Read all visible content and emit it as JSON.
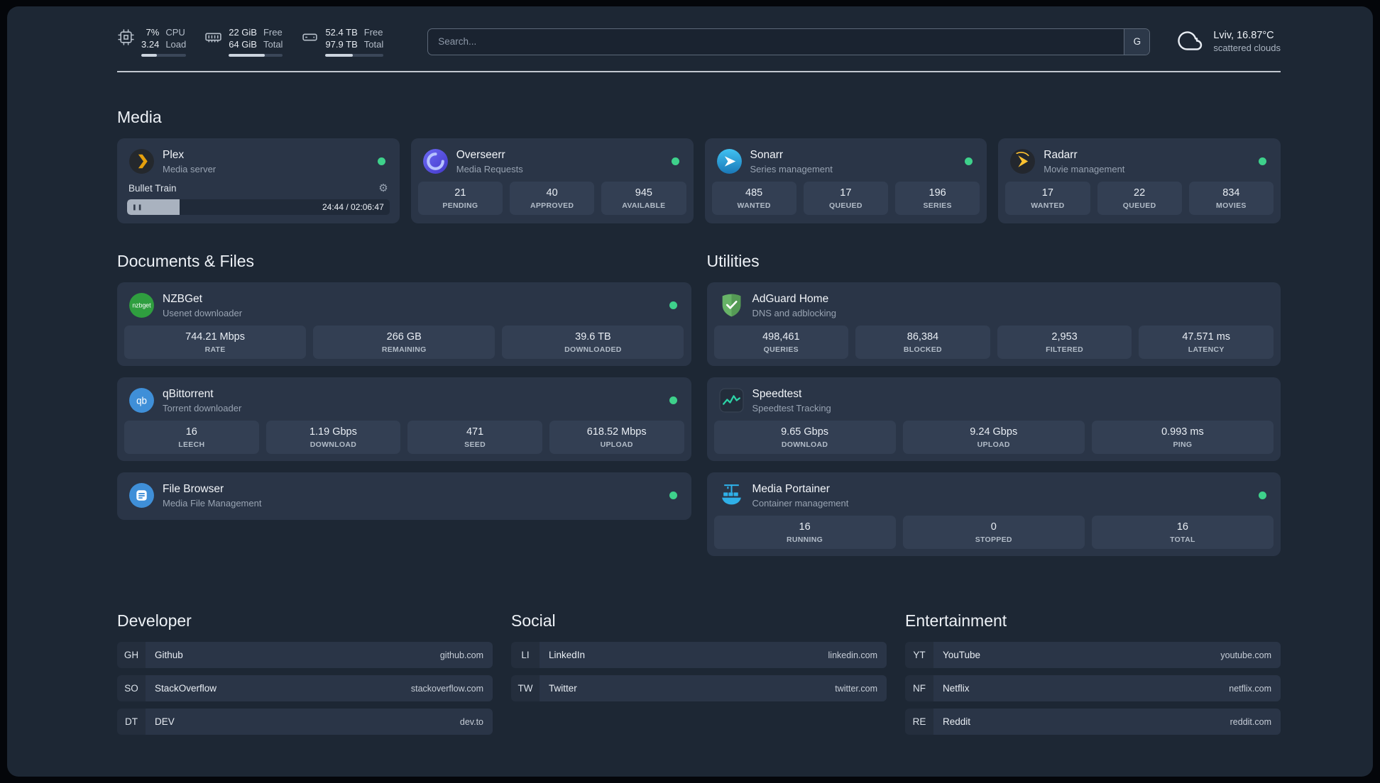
{
  "topbar": {
    "cpu": {
      "value1": "7%",
      "value2": "3.24",
      "label1": "CPU",
      "label2": "Load"
    },
    "ram": {
      "value1": "22 GiB",
      "value2": "64 GiB",
      "label1": "Free",
      "label2": "Total"
    },
    "disk": {
      "value1": "52.4 TB",
      "value2": "97.9 TB",
      "label1": "Free",
      "label2": "Total"
    },
    "search": {
      "placeholder": "Search...",
      "button_label": "G"
    },
    "weather": {
      "location": "Lviv, 16.87°C",
      "condition": "scattered clouds"
    }
  },
  "icons": {
    "gear": "⚙",
    "pause": "❚❚",
    "nzbget_label": "nzbget",
    "qbittorrent_label": "qb"
  },
  "colors": {
    "status_online": "#3ed18b",
    "plex_accent": "#e5a00d"
  },
  "sections": {
    "media": {
      "title": "Media",
      "services": [
        {
          "name": "Plex",
          "description": "Media server",
          "status": "online",
          "player": {
            "track": "Bullet Train",
            "time": "24:44 / 02:06:47"
          }
        },
        {
          "name": "Overseerr",
          "description": "Media Requests",
          "status": "online",
          "stats": [
            {
              "value": "21",
              "label": "PENDING"
            },
            {
              "value": "40",
              "label": "APPROVED"
            },
            {
              "value": "945",
              "label": "AVAILABLE"
            }
          ]
        },
        {
          "name": "Sonarr",
          "description": "Series management",
          "status": "online",
          "stats": [
            {
              "value": "485",
              "label": "WANTED"
            },
            {
              "value": "17",
              "label": "QUEUED"
            },
            {
              "value": "196",
              "label": "SERIES"
            }
          ]
        },
        {
          "name": "Radarr",
          "description": "Movie management",
          "status": "online",
          "stats": [
            {
              "value": "17",
              "label": "WANTED"
            },
            {
              "value": "22",
              "label": "QUEUED"
            },
            {
              "value": "834",
              "label": "MOVIES"
            }
          ]
        }
      ]
    },
    "documents": {
      "title": "Documents & Files",
      "services": [
        {
          "name": "NZBGet",
          "description": "Usenet downloader",
          "status": "online",
          "stats": [
            {
              "value": "744.21 Mbps",
              "label": "RATE"
            },
            {
              "value": "266 GB",
              "label": "REMAINING"
            },
            {
              "value": "39.6 TB",
              "label": "DOWNLOADED"
            }
          ]
        },
        {
          "name": "qBittorrent",
          "description": "Torrent downloader",
          "status": "online",
          "stats": [
            {
              "value": "16",
              "label": "LEECH"
            },
            {
              "value": "1.19 Gbps",
              "label": "DOWNLOAD"
            },
            {
              "value": "471",
              "label": "SEED"
            },
            {
              "value": "618.52 Mbps",
              "label": "UPLOAD"
            }
          ]
        },
        {
          "name": "File Browser",
          "description": "Media File Management",
          "status": "online"
        }
      ]
    },
    "utilities": {
      "title": "Utilities",
      "services": [
        {
          "name": "AdGuard Home",
          "description": "DNS and adblocking",
          "stats": [
            {
              "value": "498,461",
              "label": "QUERIES"
            },
            {
              "value": "86,384",
              "label": "BLOCKED"
            },
            {
              "value": "2,953",
              "label": "FILTERED"
            },
            {
              "value": "47.571 ms",
              "label": "LATENCY"
            }
          ]
        },
        {
          "name": "Speedtest",
          "description": "Speedtest Tracking",
          "stats": [
            {
              "value": "9.65 Gbps",
              "label": "DOWNLOAD"
            },
            {
              "value": "9.24 Gbps",
              "label": "UPLOAD"
            },
            {
              "value": "0.993 ms",
              "label": "PING"
            }
          ]
        },
        {
          "name": "Media Portainer",
          "description": "Container management",
          "status": "online",
          "stats": [
            {
              "value": "16",
              "label": "RUNNING"
            },
            {
              "value": "0",
              "label": "STOPPED"
            },
            {
              "value": "16",
              "label": "TOTAL"
            }
          ]
        }
      ]
    }
  },
  "bookmarks": [
    {
      "title": "Developer",
      "items": [
        {
          "abbr": "GH",
          "name": "Github",
          "domain": "github.com"
        },
        {
          "abbr": "SO",
          "name": "StackOverflow",
          "domain": "stackoverflow.com"
        },
        {
          "abbr": "DT",
          "name": "DEV",
          "domain": "dev.to"
        }
      ]
    },
    {
      "title": "Social",
      "items": [
        {
          "abbr": "LI",
          "name": "LinkedIn",
          "domain": "linkedin.com"
        },
        {
          "abbr": "TW",
          "name": "Twitter",
          "domain": "twitter.com"
        }
      ]
    },
    {
      "title": "Entertainment",
      "items": [
        {
          "abbr": "YT",
          "name": "YouTube",
          "domain": "youtube.com"
        },
        {
          "abbr": "NF",
          "name": "Netflix",
          "domain": "netflix.com"
        },
        {
          "abbr": "RE",
          "name": "Reddit",
          "domain": "reddit.com"
        }
      ]
    }
  ]
}
